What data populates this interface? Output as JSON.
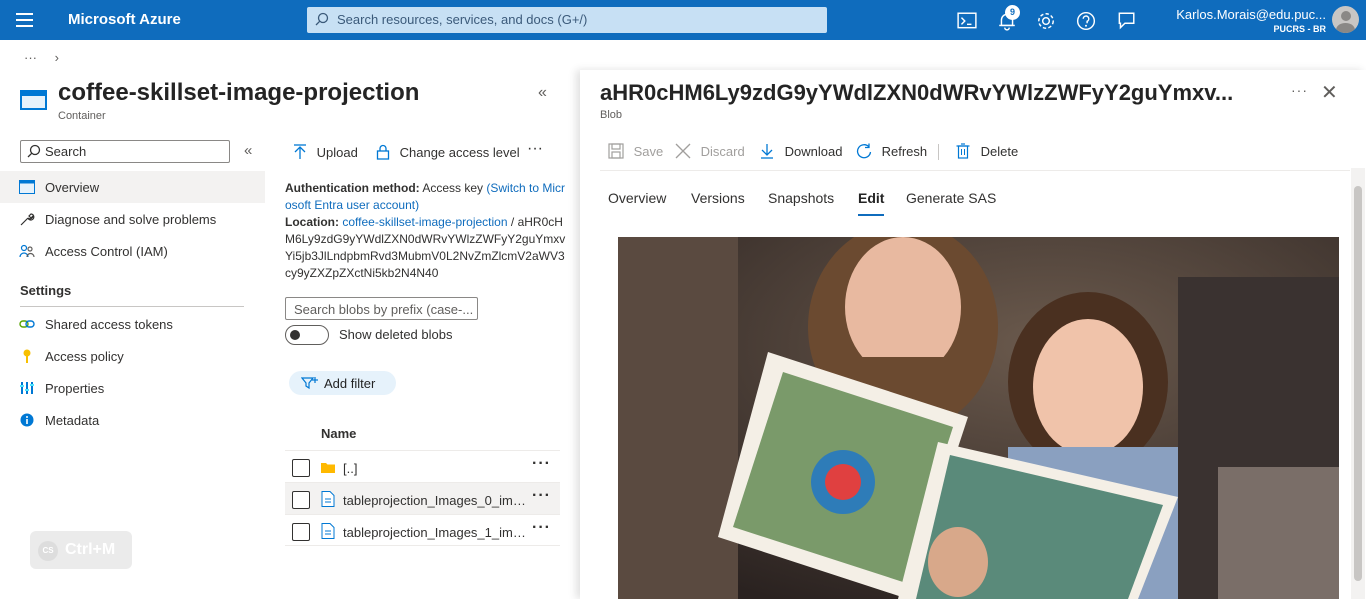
{
  "topbar": {
    "brand": "Microsoft Azure",
    "search_placeholder": "Search resources, services, and docs (G+/)",
    "notifications_count": "9",
    "user_email": "Karlos.Morais@edu.puc...",
    "user_org": "PUCRS - BR"
  },
  "breadcrumb": {
    "ellipsis": "···",
    "chevron": "›"
  },
  "container": {
    "title": "coffee-skillset-image-projection",
    "subtitle": "Container",
    "search_placeholder": "Search",
    "nav": [
      {
        "label": "Overview",
        "icon": "overview-icon"
      },
      {
        "label": "Diagnose and solve problems",
        "icon": "wrench-icon"
      },
      {
        "label": "Access Control (IAM)",
        "icon": "people-icon"
      }
    ],
    "settings_label": "Settings",
    "settings_nav": [
      {
        "label": "Shared access tokens",
        "icon": "link-icon"
      },
      {
        "label": "Access policy",
        "icon": "key-icon"
      },
      {
        "label": "Properties",
        "icon": "properties-icon"
      },
      {
        "label": "Metadata",
        "icon": "info-icon"
      }
    ]
  },
  "middle": {
    "upload": "Upload",
    "change_access": "Change access level",
    "more": "···",
    "auth_label": "Authentication method:",
    "auth_value": "Access key",
    "auth_link": "(Switch to Microsoft Entra user account)",
    "location_label": "Location:",
    "location_link": "coffee-skillset-image-projection",
    "location_sep": "/",
    "location_path": "aHR0cHM6Ly9zdG9yYWdlZXN0dWRvYWlzZWFyY2guYmxvYi5jb3JlLndpbmRvd3MubmV0L2NvZmZlcmV2aWV3cy9yZXZpZXctNi5kb2N4NO",
    "location_path_display": "aHR0cHM6Ly9zdG9yYWdlZXN0dWRvYWlzZWFyY2guYmxvYi5jb3JlLndpbmRvd3MubmV0L2NvZmZlcmV2aWV3cy9yZXZpZXctNi5kb2N4N40",
    "blob_search_placeholder": "Search blobs by prefix (case-...",
    "show_deleted": "Show deleted blobs",
    "add_filter": "Add filter",
    "col_name": "Name",
    "rows": [
      {
        "name": "[..]",
        "type": "folder"
      },
      {
        "name": "tableprojection_Images_0_img...",
        "type": "file"
      },
      {
        "name": "tableprojection_Images_1_img...",
        "type": "file"
      }
    ],
    "row_more": "···",
    "shortcut_badge": "Ctrl+M",
    "shortcut_cs": "CS"
  },
  "blob": {
    "title": "aHR0cHM6Ly9zdG9yYWdlZXN0dWRvYWlzZWFyY2guYmxv...",
    "subtitle": "Blob",
    "more": "···",
    "close": "✕",
    "commands": {
      "save": "Save",
      "discard": "Discard",
      "download": "Download",
      "refresh": "Refresh",
      "delete": "Delete"
    },
    "tabs": [
      "Overview",
      "Versions",
      "Snapshots",
      "Edit",
      "Generate SAS"
    ],
    "selected_tab": "Edit",
    "image_alt": "photo-preview"
  },
  "colors": {
    "topbar": "#0f6cbd",
    "accent": "#0f6cbd",
    "selected_nav": "#f3f2f1"
  }
}
